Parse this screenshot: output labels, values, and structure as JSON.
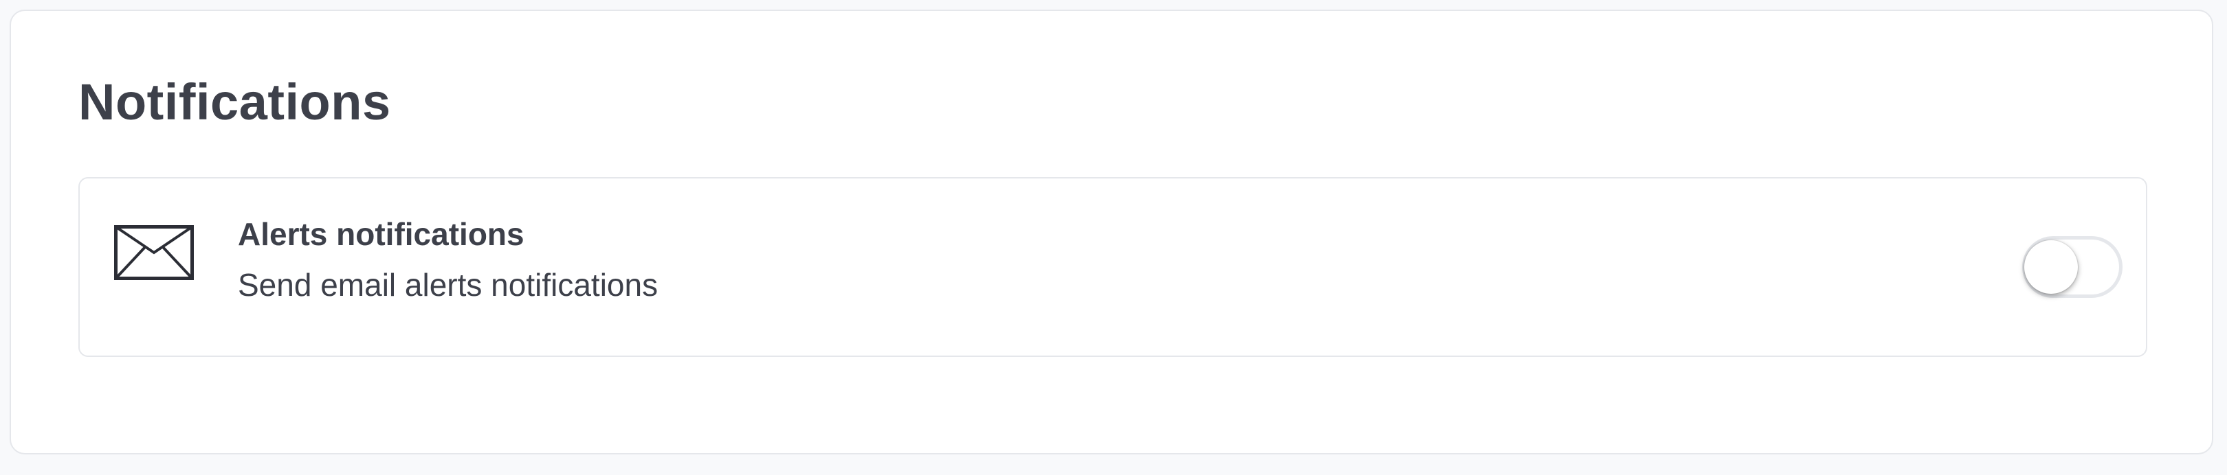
{
  "section": {
    "title": "Notifications"
  },
  "alerts_setting": {
    "icon": "envelope-icon",
    "title": "Alerts notifications",
    "description": "Send email alerts notifications",
    "enabled": false
  },
  "colors": {
    "text": "#3d404a",
    "border": "#e5e7eb",
    "background": "#f8f9fb"
  }
}
